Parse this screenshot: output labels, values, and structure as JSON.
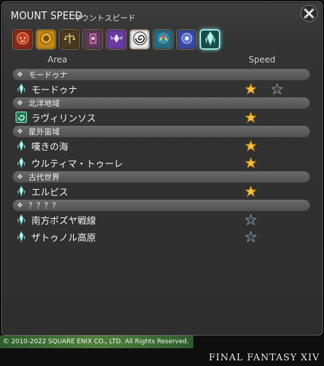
{
  "window": {
    "title": "MOUNT SPEED",
    "subtitle": "マウントスピード"
  },
  "tabs": [
    {
      "icon": "red-demon-icon",
      "color": "#8a2a1e",
      "active": false
    },
    {
      "icon": "gold-lion-icon",
      "color": "#c48a1a",
      "active": false
    },
    {
      "icon": "scales-icon",
      "color": "#4a3a22",
      "active": false
    },
    {
      "icon": "tower-icon",
      "color": "#5a3a55",
      "active": false
    },
    {
      "icon": "winged-beast-icon",
      "color": "#6a3aa0",
      "active": false
    },
    {
      "icon": "spiral-icon",
      "color": "#e8e8e8",
      "active": false
    },
    {
      "icon": "dragon-icon",
      "color": "#2a6a80",
      "active": false
    },
    {
      "icon": "starburst-icon",
      "color": "#3a4aa0",
      "active": false
    },
    {
      "icon": "aetheryte-crystal-icon",
      "color": "#1a4a4a",
      "active": true
    }
  ],
  "columns": {
    "area": "Area",
    "speed": "Speed"
  },
  "groups": [
    {
      "label": "モードゥナ",
      "rows": [
        {
          "name": "モードゥナ",
          "icon": "aetheryte-icon",
          "stars": [
            true,
            false
          ]
        }
      ]
    },
    {
      "label": "北洋地域",
      "rows": [
        {
          "name": "ラヴィリンソス",
          "icon": "labyrinthos-icon",
          "stars": [
            true
          ]
        }
      ]
    },
    {
      "label": "星外宙域",
      "rows": [
        {
          "name": "嘆きの海",
          "icon": "aetheryte-icon",
          "stars": [
            true
          ]
        },
        {
          "name": "ウルティマ・トゥーレ",
          "icon": "aetheryte-icon",
          "stars": [
            true
          ]
        }
      ]
    },
    {
      "label": "古代世界",
      "rows": [
        {
          "name": "エルピス",
          "icon": "aetheryte-icon",
          "stars": [
            true
          ]
        }
      ]
    },
    {
      "label": "？？？？",
      "rows": [
        {
          "name": "南方ボズヤ戦線",
          "icon": "aetheryte-icon",
          "stars": [
            false
          ]
        },
        {
          "name": "ザトゥノル高原",
          "icon": "aetheryte-icon",
          "stars": [
            false
          ]
        }
      ]
    }
  ],
  "footer": {
    "copyright": "© 2010-2022 SQUARE ENIX CO., LTD. All Rights Reserved.",
    "logo": "FINAL FANTASY XIV"
  },
  "colors": {
    "star_filled": "#f5c242",
    "star_empty": "#3a3f44",
    "accent": "#9ee6e0"
  }
}
